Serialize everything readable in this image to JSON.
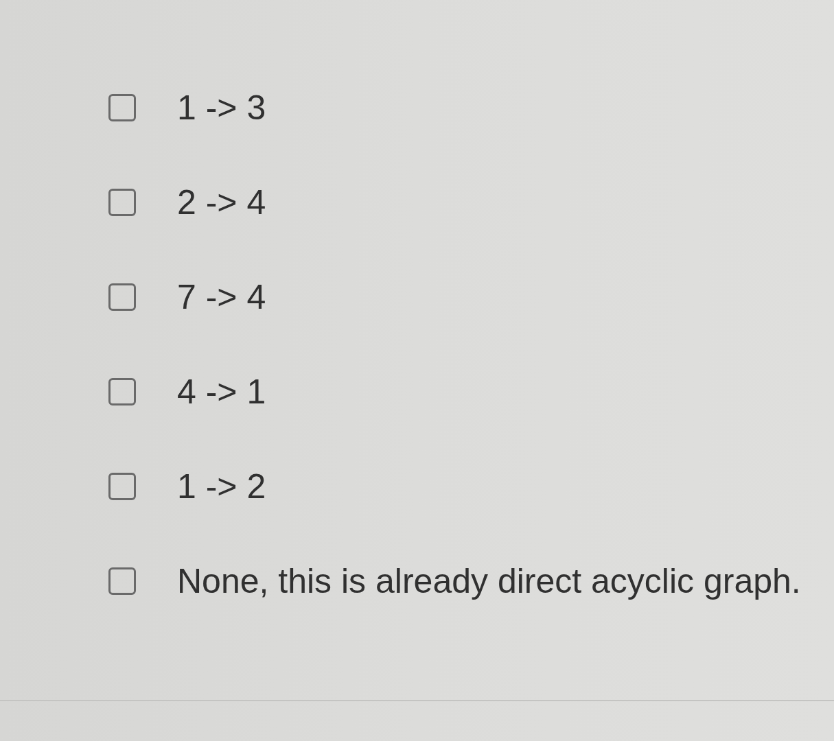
{
  "options": [
    {
      "label": "1 -> 3",
      "checked": false
    },
    {
      "label": "2 -> 4",
      "checked": false
    },
    {
      "label": "7 -> 4",
      "checked": false
    },
    {
      "label": "4 -> 1",
      "checked": false
    },
    {
      "label": "1 -> 2",
      "checked": false
    },
    {
      "label": "None, this is already direct acyclic graph.",
      "checked": false
    }
  ]
}
